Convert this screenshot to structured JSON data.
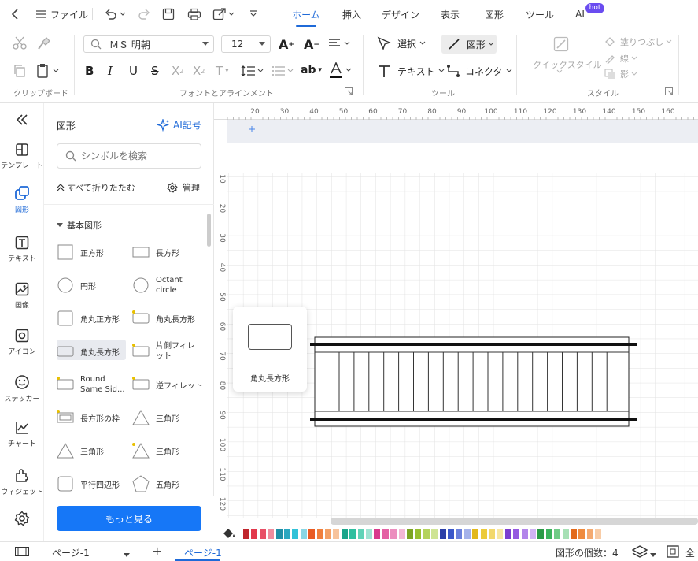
{
  "titlebar": {
    "file_label": "ファイル",
    "tabs": [
      {
        "label": "ホーム",
        "active": true
      },
      {
        "label": "挿入"
      },
      {
        "label": "デザイン"
      },
      {
        "label": "表示"
      },
      {
        "label": "図形"
      },
      {
        "label": "ツール"
      },
      {
        "label": "AI"
      }
    ],
    "hot_badge": "hot"
  },
  "ribbon": {
    "font_name": "ＭＳ 明朝",
    "font_size": "12",
    "select_label": "選択",
    "shape_label": "図形",
    "text_label": "テキスト",
    "connector_label": "コネクタ",
    "quick_style_label": "クイックスタイル",
    "fill_label": "塗りつぶし",
    "line_label": "線",
    "shadow_label": "影",
    "groups": {
      "clipboard": "クリップボード",
      "font": "フォントとアラインメント",
      "tools": "ツール",
      "style": "スタイル"
    }
  },
  "leftnav": {
    "items": [
      {
        "label": "テンプレート",
        "icon": "template-icon"
      },
      {
        "label": "図形",
        "icon": "shapes-icon",
        "active": true
      },
      {
        "label": "テキスト",
        "icon": "text-icon"
      },
      {
        "label": "画像",
        "icon": "image-icon"
      },
      {
        "label": "アイコン",
        "icon": "icon-icon"
      },
      {
        "label": "ステッカー",
        "icon": "sticker-icon"
      },
      {
        "label": "チャート",
        "icon": "chart-icon"
      },
      {
        "label": "ウィジェット",
        "icon": "widget-icon"
      }
    ]
  },
  "panel": {
    "title": "図形",
    "ai_label": "AI記号",
    "search_placeholder": "シンボルを検索",
    "collapse_label": "すべて折りたたむ",
    "manage_label": "管理",
    "section": "基本図形",
    "shapes": [
      {
        "left": "正方形",
        "right": "長方形"
      },
      {
        "left": "円形",
        "right": "Octant circle"
      },
      {
        "left": "角丸正方形",
        "right": "角丸長方形"
      },
      {
        "left": "角丸長方形",
        "right": "片側フィレット"
      },
      {
        "left": "Round Same Sid...",
        "right": "逆フィレット"
      },
      {
        "left": "長方形の枠",
        "right": "三角形"
      },
      {
        "left": "三角形",
        "right": "三角形"
      },
      {
        "left": "平行四辺形",
        "right": "五角形"
      }
    ],
    "more_button": "もっと見る"
  },
  "ruler": {
    "top_ticks": [
      "20",
      "30",
      "40",
      "50",
      "60",
      "70",
      "80",
      "90",
      "100",
      "110",
      "120",
      "130",
      "140",
      "150",
      "160"
    ],
    "left_ticks": [
      "10",
      "20",
      "30",
      "40",
      "50",
      "60",
      "70",
      "80",
      "90",
      "100",
      "110",
      "120"
    ]
  },
  "tooltip": {
    "label": "角丸長方形"
  },
  "palette": [
    "#c0262d",
    "#e2384b",
    "#e84f66",
    "#ef8c9d",
    "#1f8fa6",
    "#2aa7c0",
    "#32c2d8",
    "#8ad6e4",
    "#e95b23",
    "#f07f3c",
    "#f3a065",
    "#f7c39b",
    "#1aa58a",
    "#2dbf9f",
    "#5fd3b7",
    "#9fe3d2",
    "#d83b8c",
    "#e461a4",
    "#ec8dbe",
    "#f3b7d4",
    "#7ca423",
    "#97bf30",
    "#b4d35b",
    "#cfe493",
    "#2b3fa8",
    "#3a57c9",
    "#6a80dc",
    "#a4b2ea",
    "#e2b81c",
    "#eccb3a",
    "#f2d86b",
    "#f7e7a1",
    "#7c3fd0",
    "#9559e0",
    "#b285ea",
    "#d0b3f3",
    "#2a9a46",
    "#3bb35c",
    "#6fcb86",
    "#a7e0b5",
    "#e36a1a",
    "#ef8b3e",
    "#f4aa70",
    "#f8cca6"
  ],
  "statusbar": {
    "page_dropdown": "ページ-1",
    "page_tab": "ページ-1",
    "shape_count": "図形の個数：4",
    "fullscreen": "全"
  }
}
